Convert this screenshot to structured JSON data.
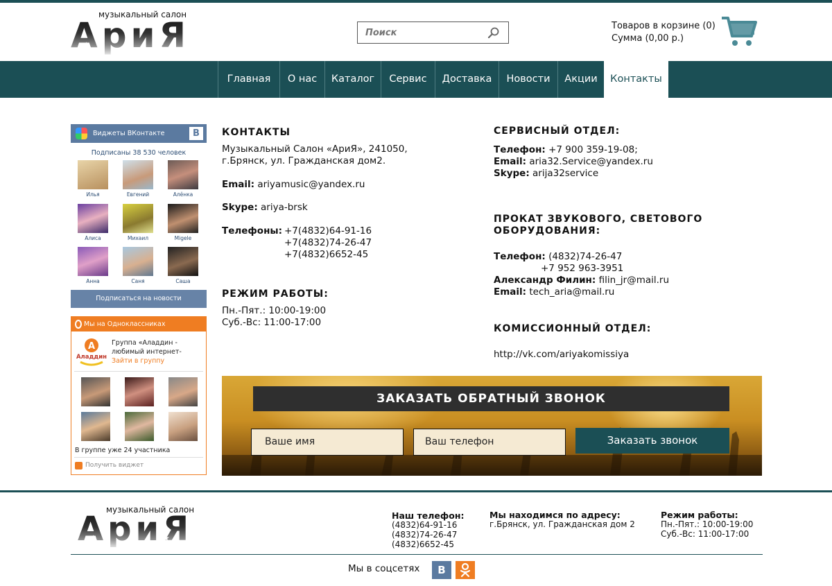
{
  "header": {
    "logo_tagline": "музыкальный салон",
    "logo_word": "АриЯ",
    "search_placeholder": "Поиск",
    "cart_line1": "Товаров в корзине (0)",
    "cart_line2": "Сумма (0,00 р.)"
  },
  "nav": {
    "items": [
      "Главная",
      "О нас",
      "Каталог",
      "Сервис",
      "Доставка",
      "Новости",
      "Акции",
      "Контакты"
    ],
    "active": "Контакты"
  },
  "vk_widget": {
    "title": "Виджеты ВКонтакте",
    "logo_letter": "В",
    "subscribers": "Подписаны 38 530 человек",
    "people": [
      "Илья",
      "Евгений",
      "Алёнка",
      "Алиса",
      "Михаил",
      "Migele",
      "Анна",
      "Саня",
      "Саша"
    ],
    "subscribe_button": "Подписаться на новости"
  },
  "ok_widget": {
    "title": "Мы на Одноклассниках",
    "group_name": "Группа «Аладдин - любимый интернет-",
    "join": "Зайти в группу",
    "logo_text": "Аладдин",
    "members_count": "В группе уже 24 участника",
    "get_widget": "Получить виджет"
  },
  "contacts": {
    "title": "КОНТАКТЫ",
    "address_line1": "Музыкальный Салон «АриЯ», 241050,",
    "address_line2": "г.Брянск, ул. Гражданская дом2.",
    "email_label": "Email:",
    "email": "ariyamusic@yandex.ru",
    "skype_label": "Skype:",
    "skype": "ariya-brsk",
    "phones_label": "Телефоны:",
    "phones": [
      "+7(4832)64-91-16",
      "+7(4832)74-26-47",
      "+7(4832)6652-45"
    ]
  },
  "hours": {
    "title": "РЕЖИМ РАБОТЫ:",
    "line1": "Пн.-Пят.: 10:00-19:00",
    "line2": "Суб.-Вс: 11:00-17:00"
  },
  "service": {
    "title": "СЕРВИСНЫЙ ОТДЕЛ:",
    "phone_label": "Телефон:",
    "phone": "+7 900 359-19-08;",
    "email_label": "Email:",
    "email": "aria32.Service@yandex.ru",
    "skype_label": "Skype:",
    "skype": "arija32service"
  },
  "rental": {
    "title_line1": "ПРОКАТ ЗВУКОВОГО, СВЕТОВОГО",
    "title_line2": "ОБОРУДОВАНИЯ:",
    "phone_label": "Телефон:",
    "phone1": "(4832)74-26-47",
    "phone2": "+7 952 963-3951",
    "person_label": "Александр Филин:",
    "person_email": "filin_jr@mail.ru",
    "email_label": "Email:",
    "email": "tech_aria@mail.ru"
  },
  "commission": {
    "title": "КОМИССИОННЫЙ ОТДЕЛ:",
    "link": "http://vk.com/ariyakomissiya"
  },
  "callback": {
    "title": "ЗАКАЗАТЬ ОБРАТНЫЙ ЗВОНОК",
    "name_placeholder": "Ваше имя",
    "phone_placeholder": "Ваш телефон",
    "button": "Заказать звонок"
  },
  "footer": {
    "logo_tagline": "музыкальный салон",
    "logo_word": "АриЯ",
    "phone_title": "Наш телефон:",
    "phones": [
      "(4832)64-91-16",
      "(4832)74-26-47",
      "(4832)6652-45"
    ],
    "address_title": "Мы находимся по адресу:",
    "address": "г.Брянск, ул. Гражданская дом 2",
    "hours_title": "Режим работы:",
    "hours_line1": "Пн.-Пят.: 10:00-19:00",
    "hours_line2": "Суб.-Вс: 11:00-17:00",
    "social_label": "Мы в соцсетях",
    "vk_letter": "В"
  },
  "colors": {
    "brand_teal": "#1b4f55",
    "vk_blue": "#5b7aa0",
    "ok_orange": "#ef7d22",
    "cart_teal": "#4a8a96"
  }
}
